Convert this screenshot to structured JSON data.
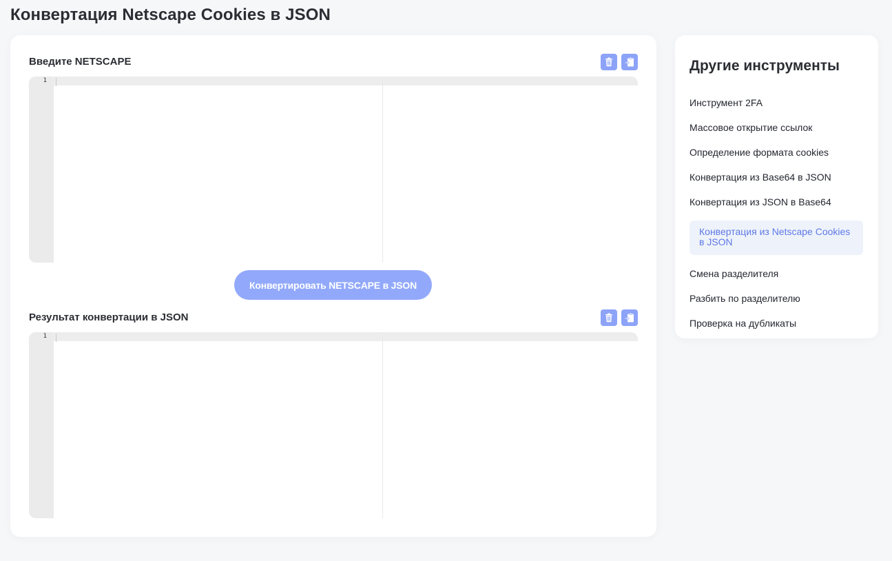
{
  "page": {
    "title": "Конвертация Netscape Cookies в JSON"
  },
  "input_section": {
    "label": "Введите NETSCAPE",
    "line_number": "1",
    "value": "",
    "clear_icon": "trash-icon",
    "paste_icon": "clipboard-paste-icon"
  },
  "convert_button": {
    "label": "Конвертировать NETSCAPE в JSON"
  },
  "output_section": {
    "label": "Результат конвертации в JSON",
    "line_number": "1",
    "value": "",
    "clear_icon": "trash-icon",
    "copy_icon": "clipboard-icon"
  },
  "sidebar": {
    "title": "Другие инструменты",
    "items": [
      {
        "label": "Инструмент 2FA",
        "active": false
      },
      {
        "label": "Массовое открытие ссылок",
        "active": false
      },
      {
        "label": "Определение формата cookies",
        "active": false
      },
      {
        "label": "Конвертация из Base64 в JSON",
        "active": false
      },
      {
        "label": "Конвертация из JSON в Base64",
        "active": false
      },
      {
        "label": "Конвертация из Netscape Cookies в JSON",
        "active": true
      },
      {
        "label": "Смена разделителя",
        "active": false
      },
      {
        "label": "Разбить по разделителю",
        "active": false
      },
      {
        "label": "Проверка на дубликаты",
        "active": false
      }
    ]
  },
  "colors": {
    "accent": "#92a9fb",
    "icon_button": "#8ca3f8",
    "active_item_bg": "#eef3fb",
    "active_item_text": "#5f78e6",
    "page_bg": "#f6f7f9",
    "card_bg": "#ffffff"
  }
}
